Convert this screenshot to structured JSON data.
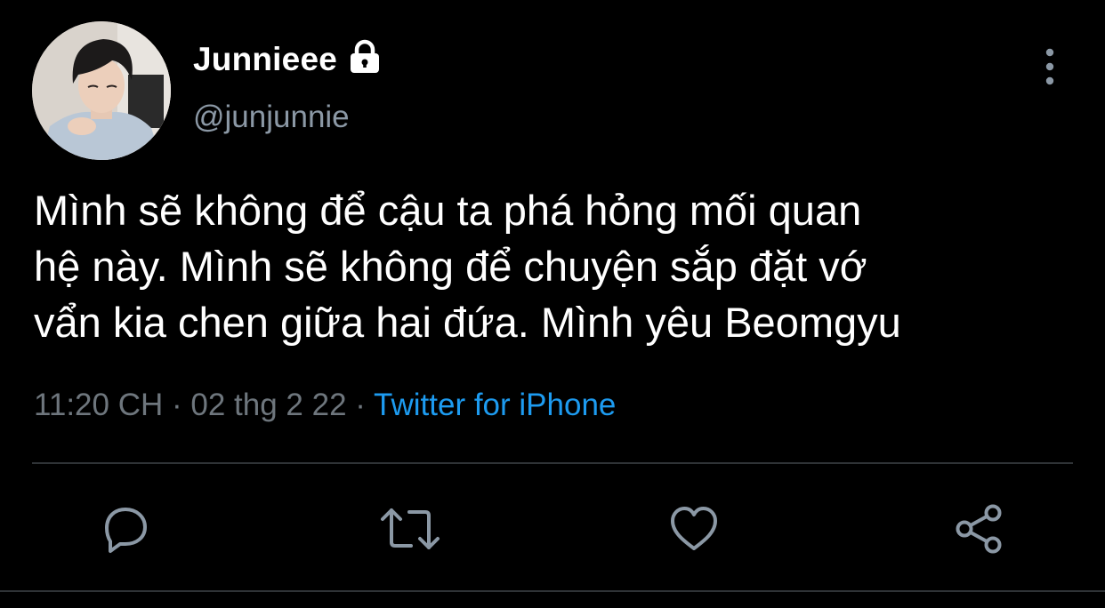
{
  "user": {
    "display_name": "Junnieee",
    "handle": "@junjunnie",
    "protected_icon": "lock-icon"
  },
  "tweet": {
    "text": "Mình sẽ không để cậu ta phá hỏng mối quan\nhệ này. Mình sẽ không để chuyện sắp đặt vớ\nvẩn kia chen giữa hai đứa. Mình yêu Beomgyu",
    "time": "11:20 CH",
    "separator": "·",
    "date": "02 thg 2 22",
    "source": "Twitter for iPhone"
  },
  "actions": {
    "reply_icon": "reply-icon",
    "retweet_icon": "retweet-icon",
    "like_icon": "heart-icon",
    "share_icon": "share-icon"
  },
  "colors": {
    "background": "#000000",
    "text_primary": "#ffffff",
    "text_secondary": "#6e767d",
    "accent": "#1d9bf0",
    "divider": "#2f3336",
    "icon": "#8b98a5"
  }
}
